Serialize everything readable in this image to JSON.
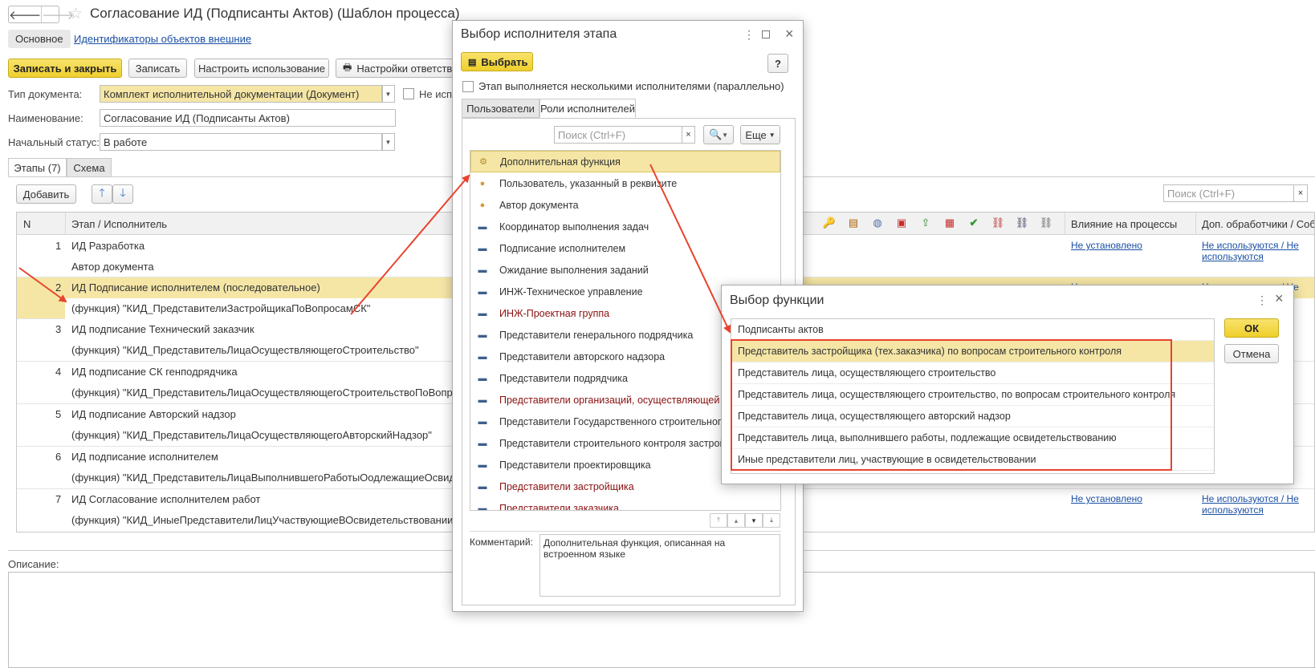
{
  "main": {
    "title": "Согласование ИД (Подписанты Актов) (Шаблон процесса)",
    "nav_tabs": [
      "Основное",
      "Идентификаторы объектов внешние"
    ],
    "buttons": {
      "save_close": "Записать и закрыть",
      "save": "Записать",
      "configure": "Настроить использование",
      "responsible": "Настройки ответстве"
    },
    "fields": {
      "doc_type_label": "Тип документа:",
      "doc_type_value": "Комплект исполнительной документации (Документ)",
      "checkbox_label": "Не испо",
      "name_label": "Наименование:",
      "name_value": "Согласование ИД (Подписанты Актов)",
      "status_label": "Начальный статус:",
      "status_value": "В работе"
    },
    "tabs": [
      "Этапы (7)",
      "Схема"
    ],
    "add_button": "Добавить",
    "search_placeholder": "Поиск (Ctrl+F)",
    "table": {
      "headers": {
        "n": "N",
        "stage": "Этап / Исполнитель",
        "influence": "Влияние на процессы",
        "handlers": "Доп. обработчики / Собы"
      },
      "rows": [
        {
          "n": "1",
          "text": "ИД Разработка",
          "sub": "Автор документа",
          "influence": "Не установлено",
          "handlers": "Не используются / Не используются"
        },
        {
          "n": "2",
          "text": "ИД Подписание исполнителем (последовательное)",
          "sub": "(функция) \"КИД_ПредставителиЗастройщикаПоВопросамСК\"",
          "influence": "Не установлено",
          "handlers": "Не используются / Не"
        },
        {
          "n": "3",
          "text": "ИД подписание Технический заказчик",
          "sub": "(функция) \"КИД_ПредставительЛицаОсуществляющегоСтроительство\"",
          "influence": "",
          "handlers": ""
        },
        {
          "n": "4",
          "text": "ИД подписание СК генподрядчика",
          "sub": "(функция) \"КИД_ПредставительЛицаОсуществляющегоСтроительствоПоВопросамС",
          "influence": "",
          "handlers": ""
        },
        {
          "n": "5",
          "text": "ИД подписание Авторский надзор",
          "sub": "(функция) \"КИД_ПредставительЛицаОсуществляющегоАвторскийНадзор\"",
          "influence": "",
          "handlers": ""
        },
        {
          "n": "6",
          "text": "ИД подписание исполнителем",
          "sub": "(функция) \"КИД_ПредставительЛицаВыполнившегоРаботыОодлежащиеОсвидетельс",
          "influence": "",
          "handlers": ""
        },
        {
          "n": "7",
          "text": "ИД Согласование исполнителем работ",
          "sub": "(функция) \"КИД_ИныеПредставителиЛицУчаствующиеВОсвидетельствовании\"",
          "influence": "Не установлено",
          "handlers": "Не используются / Не используются"
        }
      ]
    },
    "description_label": "Описание:"
  },
  "dialog1": {
    "title": "Выбор исполнителя этапа",
    "select_button": "Выбрать",
    "help": "?",
    "parallel_checkbox": "Этап выполняется несколькими исполнителями (параллельно)",
    "tabs": [
      "Пользователи",
      "Роли исполнителей"
    ],
    "search_placeholder": "Поиск (Ctrl+F)",
    "more_button": "Еще",
    "items": [
      {
        "label": "Дополнительная функция",
        "icon": "function-gear-icon",
        "red": false
      },
      {
        "label": "Пользователь, указанный в реквизите",
        "icon": "user-icon",
        "red": false
      },
      {
        "label": "Автор документа",
        "icon": "user-icon",
        "red": false
      },
      {
        "label": "Координатор выполнения задач",
        "icon": "role-star-icon",
        "red": false
      },
      {
        "label": "Подписание исполнителем",
        "icon": "role-icon",
        "red": false
      },
      {
        "label": "Ожидание выполнения заданий",
        "icon": "role-icon",
        "red": false
      },
      {
        "label": "ИНЖ-Техническое управление",
        "icon": "role-icon",
        "red": false
      },
      {
        "label": "ИНЖ-Проектная группа",
        "icon": "role-icon",
        "red": true
      },
      {
        "label": "Представители генерального подрядчика",
        "icon": "role-icon",
        "red": false
      },
      {
        "label": "Представители авторского надзора",
        "icon": "role-icon",
        "red": false
      },
      {
        "label": "Представители подрядчика",
        "icon": "role-icon",
        "red": false
      },
      {
        "label": "Представители организаций, осуществляющей экс",
        "icon": "role-icon",
        "red": true
      },
      {
        "label": "Представители Государственного строительного на",
        "icon": "role-icon",
        "red": false
      },
      {
        "label": "Представители строительного контроля застройщ",
        "icon": "role-icon",
        "red": false
      },
      {
        "label": "Представители проектировщика",
        "icon": "role-icon",
        "red": false
      },
      {
        "label": "Представители застройщика",
        "icon": "role-icon",
        "red": true
      },
      {
        "label": "Представители заказчика",
        "icon": "role-icon",
        "red": true
      }
    ],
    "comment_label": "Комментарий:",
    "comment_text": "Дополнительная функция, описанная на встроенном языке"
  },
  "dialog2": {
    "title": "Выбор функции",
    "ok": "ОК",
    "cancel": "Отмена",
    "items": [
      "Подписанты актов",
      "Представитель застройщика (тех.заказчика) по вопросам строительного контроля",
      "Представитель лица, осуществляющего строительство",
      "Представитель лица, осуществляющего строительство, по вопросам строительного контроля",
      "Представитель лица, осуществляющего авторский надзор",
      "Представитель лица, выполнившего работы, подлежащие освидетельствованию",
      "Иные представители лиц, участвующие в освидетельствовании"
    ]
  },
  "colors": {
    "accent_yellow": "#f0d23a",
    "selected_row": "#f5e6a6",
    "annotation_red": "#e8432d",
    "link": "#1a4fa3"
  }
}
